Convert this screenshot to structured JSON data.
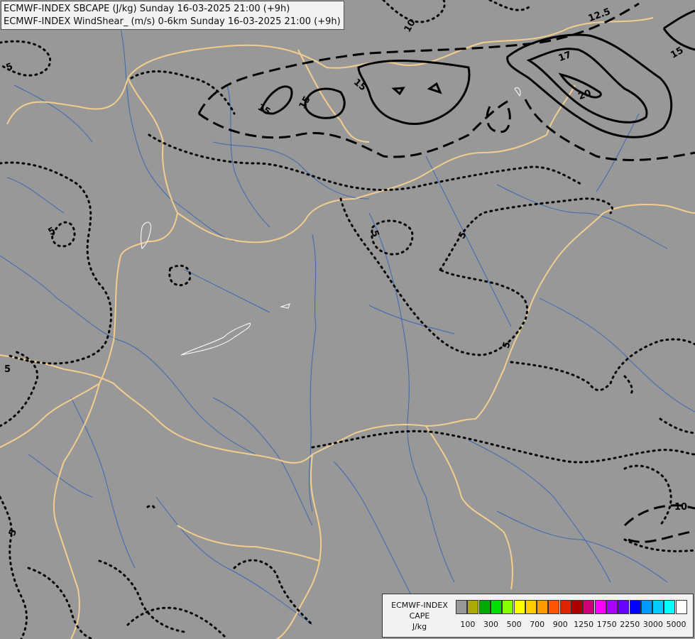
{
  "header": {
    "line1": "ECMWF-INDEX SBCAPE (J/kg) Sunday 16-03-2025 21:00 (+9h)",
    "line2": "ECMWF-INDEX WindShear_ (m/s) 0-6km Sunday 16-03-2025 21:00 (+9h)"
  },
  "map": {
    "background_color": "#989898",
    "border_color": "#f3cd8e",
    "river_color": "#3d68b5",
    "contour_labels": [
      "5",
      "10",
      "12.5",
      "15",
      "17",
      "20"
    ]
  },
  "legend": {
    "title_lines": [
      "ECMWF-INDEX",
      "CAPE",
      "J/kg"
    ],
    "colors": [
      "#999999",
      "#aaaa00",
      "#00aa00",
      "#00dd00",
      "#88ff00",
      "#ffff00",
      "#ffcc00",
      "#ff9900",
      "#ff5500",
      "#dd2200",
      "#aa0000",
      "#cc0077",
      "#ff00ff",
      "#aa00ff",
      "#6600ff",
      "#0000ff",
      "#0099ff",
      "#00ccff",
      "#00ffff",
      "#ffffff"
    ],
    "tick_labels": [
      "100",
      "300",
      "500",
      "700",
      "900",
      "1250",
      "1750",
      "2250",
      "3000",
      "5000"
    ]
  }
}
